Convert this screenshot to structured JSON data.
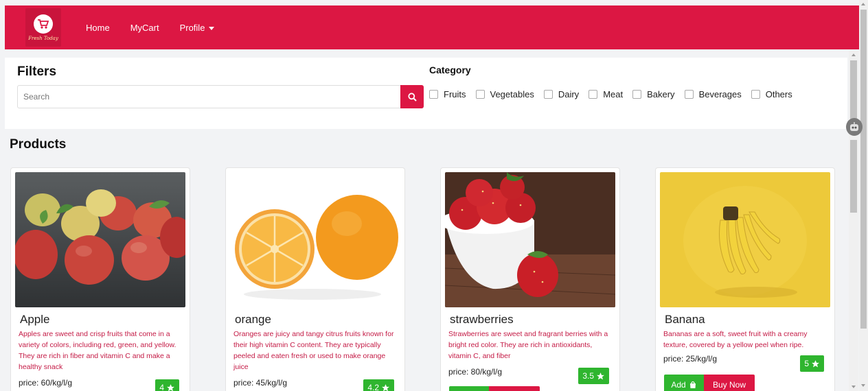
{
  "brand": {
    "logo_text": "Fresh Today"
  },
  "nav": {
    "home": "Home",
    "mycart": "MyCart",
    "profile": "Profile"
  },
  "filters": {
    "title": "Filters",
    "search_placeholder": "Search",
    "category_title": "Category",
    "categories": [
      "Fruits",
      "Vegetables",
      "Dairy",
      "Meat",
      "Bakery",
      "Beverages",
      "Others"
    ]
  },
  "products": {
    "title": "Products",
    "items": [
      {
        "name": "Apple",
        "description": "Apples are sweet and crisp fruits that come in a variety of colors, including red, green, and yellow. They are rich in fiber and vitamin C and make a healthy snack",
        "price": "price: 60/kg/l/g",
        "rating": "4"
      },
      {
        "name": "orange",
        "description": "Oranges are juicy and tangy citrus fruits known for their high vitamin C content. They are typically peeled and eaten fresh or used to make orange juice",
        "price": "price: 45/kg/l/g",
        "rating": "4.2"
      },
      {
        "name": "strawberries",
        "description": "Strawberries are sweet and fragrant berries with a bright red color. They are rich in antioxidants, vitamin C, and fiber",
        "price": "price: 80/kg/l/g",
        "rating": "3.5"
      },
      {
        "name": "Banana",
        "description": "Bananas are a soft, sweet fruit with a creamy texture, covered by a yellow peel when ripe.",
        "price": "price: 25/kg/l/g",
        "rating": "5"
      }
    ],
    "add_label": "Add",
    "buy_label": "Buy Now"
  },
  "colors": {
    "brand_red": "#dc1743",
    "rating_green": "#2fb52f",
    "desc_red": "#c41a45"
  }
}
